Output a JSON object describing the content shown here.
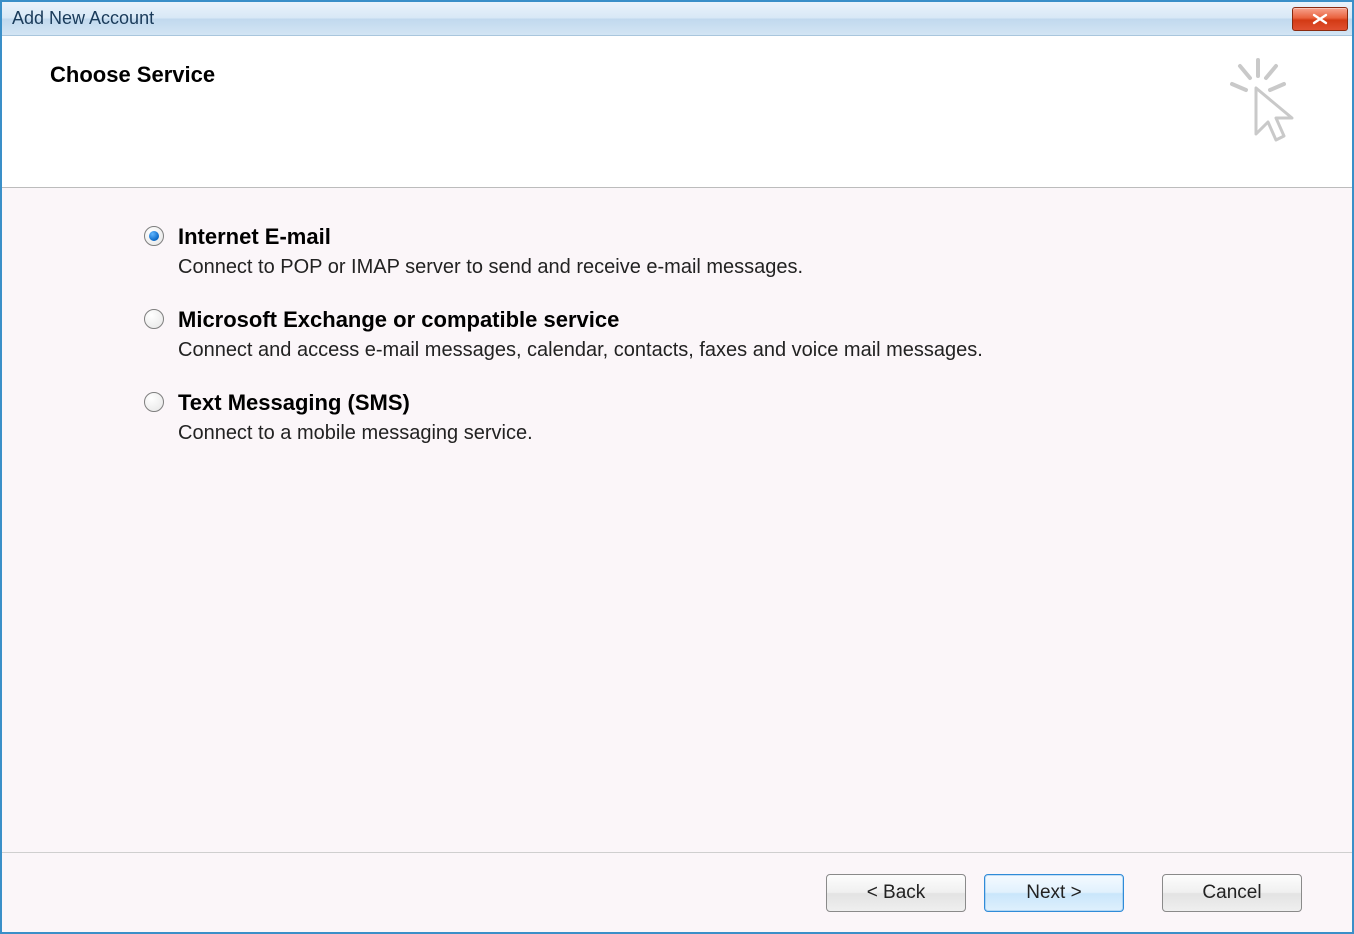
{
  "window": {
    "title": "Add New Account"
  },
  "header": {
    "title": "Choose Service"
  },
  "options": [
    {
      "title": "Internet E-mail",
      "description": "Connect to POP or IMAP server to send and receive e-mail messages.",
      "selected": true
    },
    {
      "title": "Microsoft Exchange or compatible service",
      "description": "Connect and access e-mail messages, calendar, contacts, faxes and voice mail messages.",
      "selected": false
    },
    {
      "title": "Text Messaging (SMS)",
      "description": "Connect to a mobile messaging service.",
      "selected": false
    }
  ],
  "footer": {
    "back": "< Back",
    "next": "Next >",
    "cancel": "Cancel"
  }
}
